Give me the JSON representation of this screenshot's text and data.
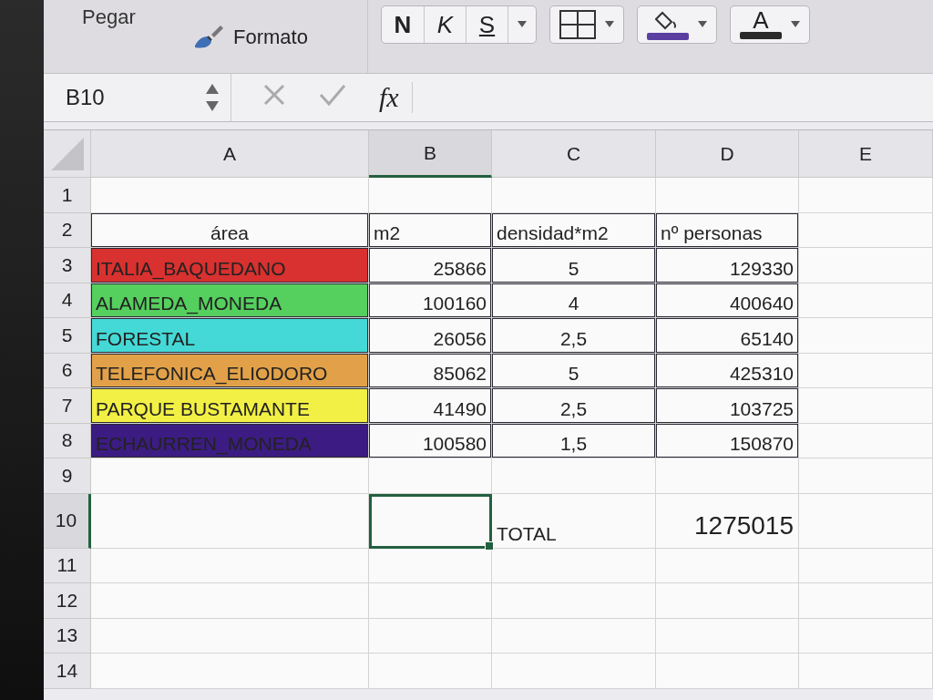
{
  "ribbon": {
    "paste_label": "Pegar",
    "format_label": "Formato",
    "font_buttons": [
      {
        "label": "N",
        "kind": "bold"
      },
      {
        "label": "K",
        "kind": "italic"
      },
      {
        "label": "S",
        "kind": "underline"
      }
    ],
    "font_color_label": "A"
  },
  "formula_bar": {
    "name_box": "B10",
    "fx_label": "fx"
  },
  "columns": [
    {
      "label": "A",
      "selected": false
    },
    {
      "label": "B",
      "selected": true
    },
    {
      "label": "C",
      "selected": false
    },
    {
      "label": "D",
      "selected": false
    },
    {
      "label": "E",
      "selected": false
    }
  ],
  "rows": [
    {
      "number": "1",
      "selected": false,
      "kind": "blank",
      "cells": {}
    },
    {
      "number": "2",
      "selected": false,
      "kind": "header",
      "cells": {
        "A": {
          "text": "área",
          "selected": false
        },
        "B": {
          "text": "m2",
          "selected": false
        },
        "C": {
          "text": "densidad*m2",
          "selected": false
        },
        "D": {
          "text": "nº personas",
          "selected": false
        }
      }
    },
    {
      "number": "3",
      "selected": false,
      "kind": "data",
      "cells": {
        "A": {
          "text": "ITALIA_BAQUEDANO",
          "color": "#d8312f",
          "selected": false
        },
        "B": {
          "text": "25866",
          "selected": false
        },
        "C": {
          "text": "5",
          "selected": false
        },
        "D": {
          "text": "129330",
          "selected": false
        }
      }
    },
    {
      "number": "4",
      "selected": false,
      "kind": "data",
      "cells": {
        "A": {
          "text": "ALAMEDA_MONEDA",
          "color": "#55cf5e",
          "selected": false
        },
        "B": {
          "text": "100160",
          "selected": false
        },
        "C": {
          "text": "4",
          "selected": false
        },
        "D": {
          "text": "400640",
          "selected": false
        }
      }
    },
    {
      "number": "5",
      "selected": false,
      "kind": "data",
      "cells": {
        "A": {
          "text": "FORESTAL",
          "color": "#44d9d6",
          "selected": false
        },
        "B": {
          "text": "26056",
          "selected": false
        },
        "C": {
          "text": "2,5",
          "selected": false
        },
        "D": {
          "text": "65140",
          "selected": false
        }
      }
    },
    {
      "number": "6",
      "selected": false,
      "kind": "data",
      "cells": {
        "A": {
          "text": "TELEFONICA_ELIODORO",
          "color": "#e2a148",
          "selected": false
        },
        "B": {
          "text": "85062",
          "selected": false
        },
        "C": {
          "text": "5",
          "selected": false
        },
        "D": {
          "text": "425310",
          "selected": false
        }
      }
    },
    {
      "number": "7",
      "selected": false,
      "kind": "data",
      "cells": {
        "A": {
          "text": "PARQUE BUSTAMANTE",
          "color": "#f2f044",
          "selected": false
        },
        "B": {
          "text": "41490",
          "selected": false
        },
        "C": {
          "text": "2,5",
          "selected": false
        },
        "D": {
          "text": "103725",
          "selected": false
        }
      }
    },
    {
      "number": "8",
      "selected": false,
      "kind": "data",
      "cells": {
        "A": {
          "text": "ECHAURREN_MONEDA",
          "color": "#3c1c82",
          "selected": false
        },
        "B": {
          "text": "100580",
          "selected": false
        },
        "C": {
          "text": "1,5",
          "selected": false
        },
        "D": {
          "text": "150870",
          "selected": false
        }
      }
    },
    {
      "number": "9",
      "selected": false,
      "kind": "blank",
      "cells": {}
    },
    {
      "number": "10",
      "selected": true,
      "kind": "total",
      "cells": {
        "B": {
          "selected": true
        },
        "C": {
          "text": "TOTAL",
          "selected": false
        },
        "D": {
          "text": "1275015",
          "selected": false
        }
      }
    },
    {
      "number": "11",
      "selected": false,
      "kind": "blank",
      "cells": {}
    },
    {
      "number": "12",
      "selected": false,
      "kind": "blank",
      "cells": {}
    },
    {
      "number": "13",
      "selected": false,
      "kind": "blank",
      "cells": {}
    },
    {
      "number": "14",
      "selected": false,
      "kind": "blank",
      "cells": {}
    }
  ]
}
